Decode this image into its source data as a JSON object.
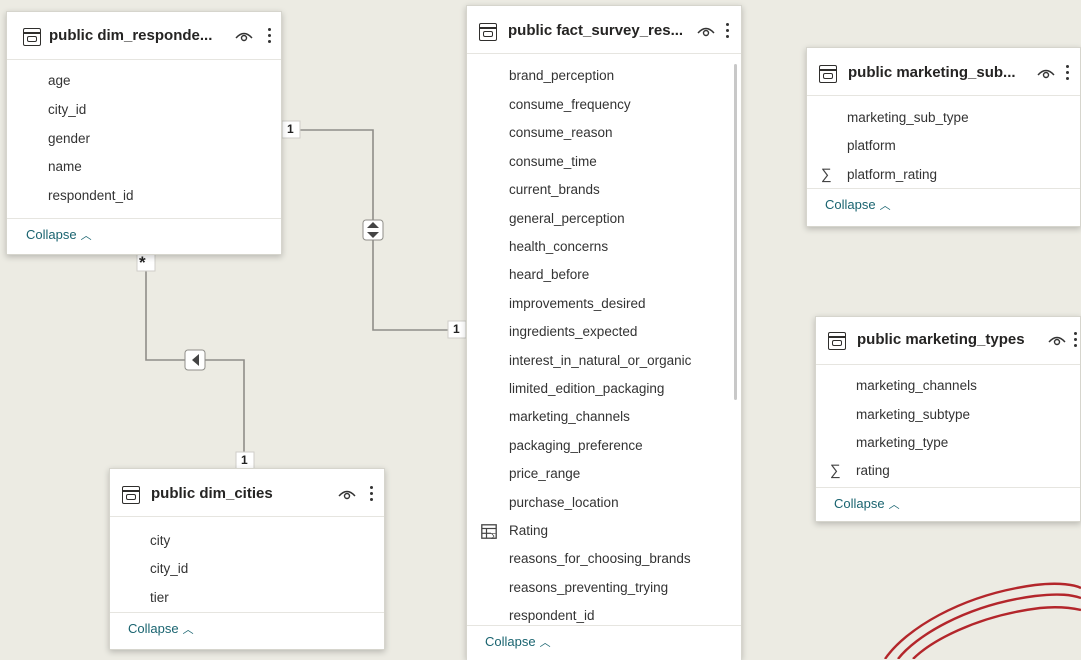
{
  "tables": {
    "dim_respondents": {
      "title": "public dim_responde...",
      "fields": [
        "age",
        "city_id",
        "gender",
        "name",
        "respondent_id"
      ],
      "collapse_label": "Collapse"
    },
    "fact_survey": {
      "title": "public fact_survey_res...",
      "fields": [
        "brand_perception",
        "consume_frequency",
        "consume_reason",
        "consume_time",
        "current_brands",
        "general_perception",
        "health_concerns",
        "heard_before",
        "improvements_desired",
        "ingredients_expected",
        "interest_in_natural_or_organic",
        "limited_edition_packaging",
        "marketing_channels",
        "packaging_preference",
        "price_range",
        "purchase_location",
        "Rating",
        "reasons_for_choosing_brands",
        "reasons_preventing_trying",
        "respondent_id"
      ],
      "collapse_label": "Collapse"
    },
    "marketing_sub": {
      "title": "public marketing_sub...",
      "fields": [
        "marketing_sub_type",
        "platform",
        "platform_rating"
      ],
      "collapse_label": "Collapse"
    },
    "marketing_types": {
      "title": "public marketing_types",
      "fields": [
        "marketing_channels",
        "marketing_subtype",
        "marketing_type",
        "rating"
      ],
      "collapse_label": "Collapse"
    },
    "dim_cities": {
      "title": "public dim_cities",
      "fields": [
        "city",
        "city_id",
        "tier"
      ],
      "collapse_label": "Collapse"
    }
  },
  "relationships": {
    "respondents_fact": {
      "from_label": "1",
      "to_label": "1",
      "direction": "both"
    },
    "respondents_cities": {
      "from_label": "*",
      "to_label": "1",
      "direction": "left"
    }
  },
  "field_icons": {
    "sigma": "∑",
    "measure": "calculator-table-icon"
  },
  "colors": {
    "background": "#ECEBE3",
    "card": "#FFFFFF",
    "collapse_link": "#1A6470",
    "annotation_red": "#B3262B"
  }
}
